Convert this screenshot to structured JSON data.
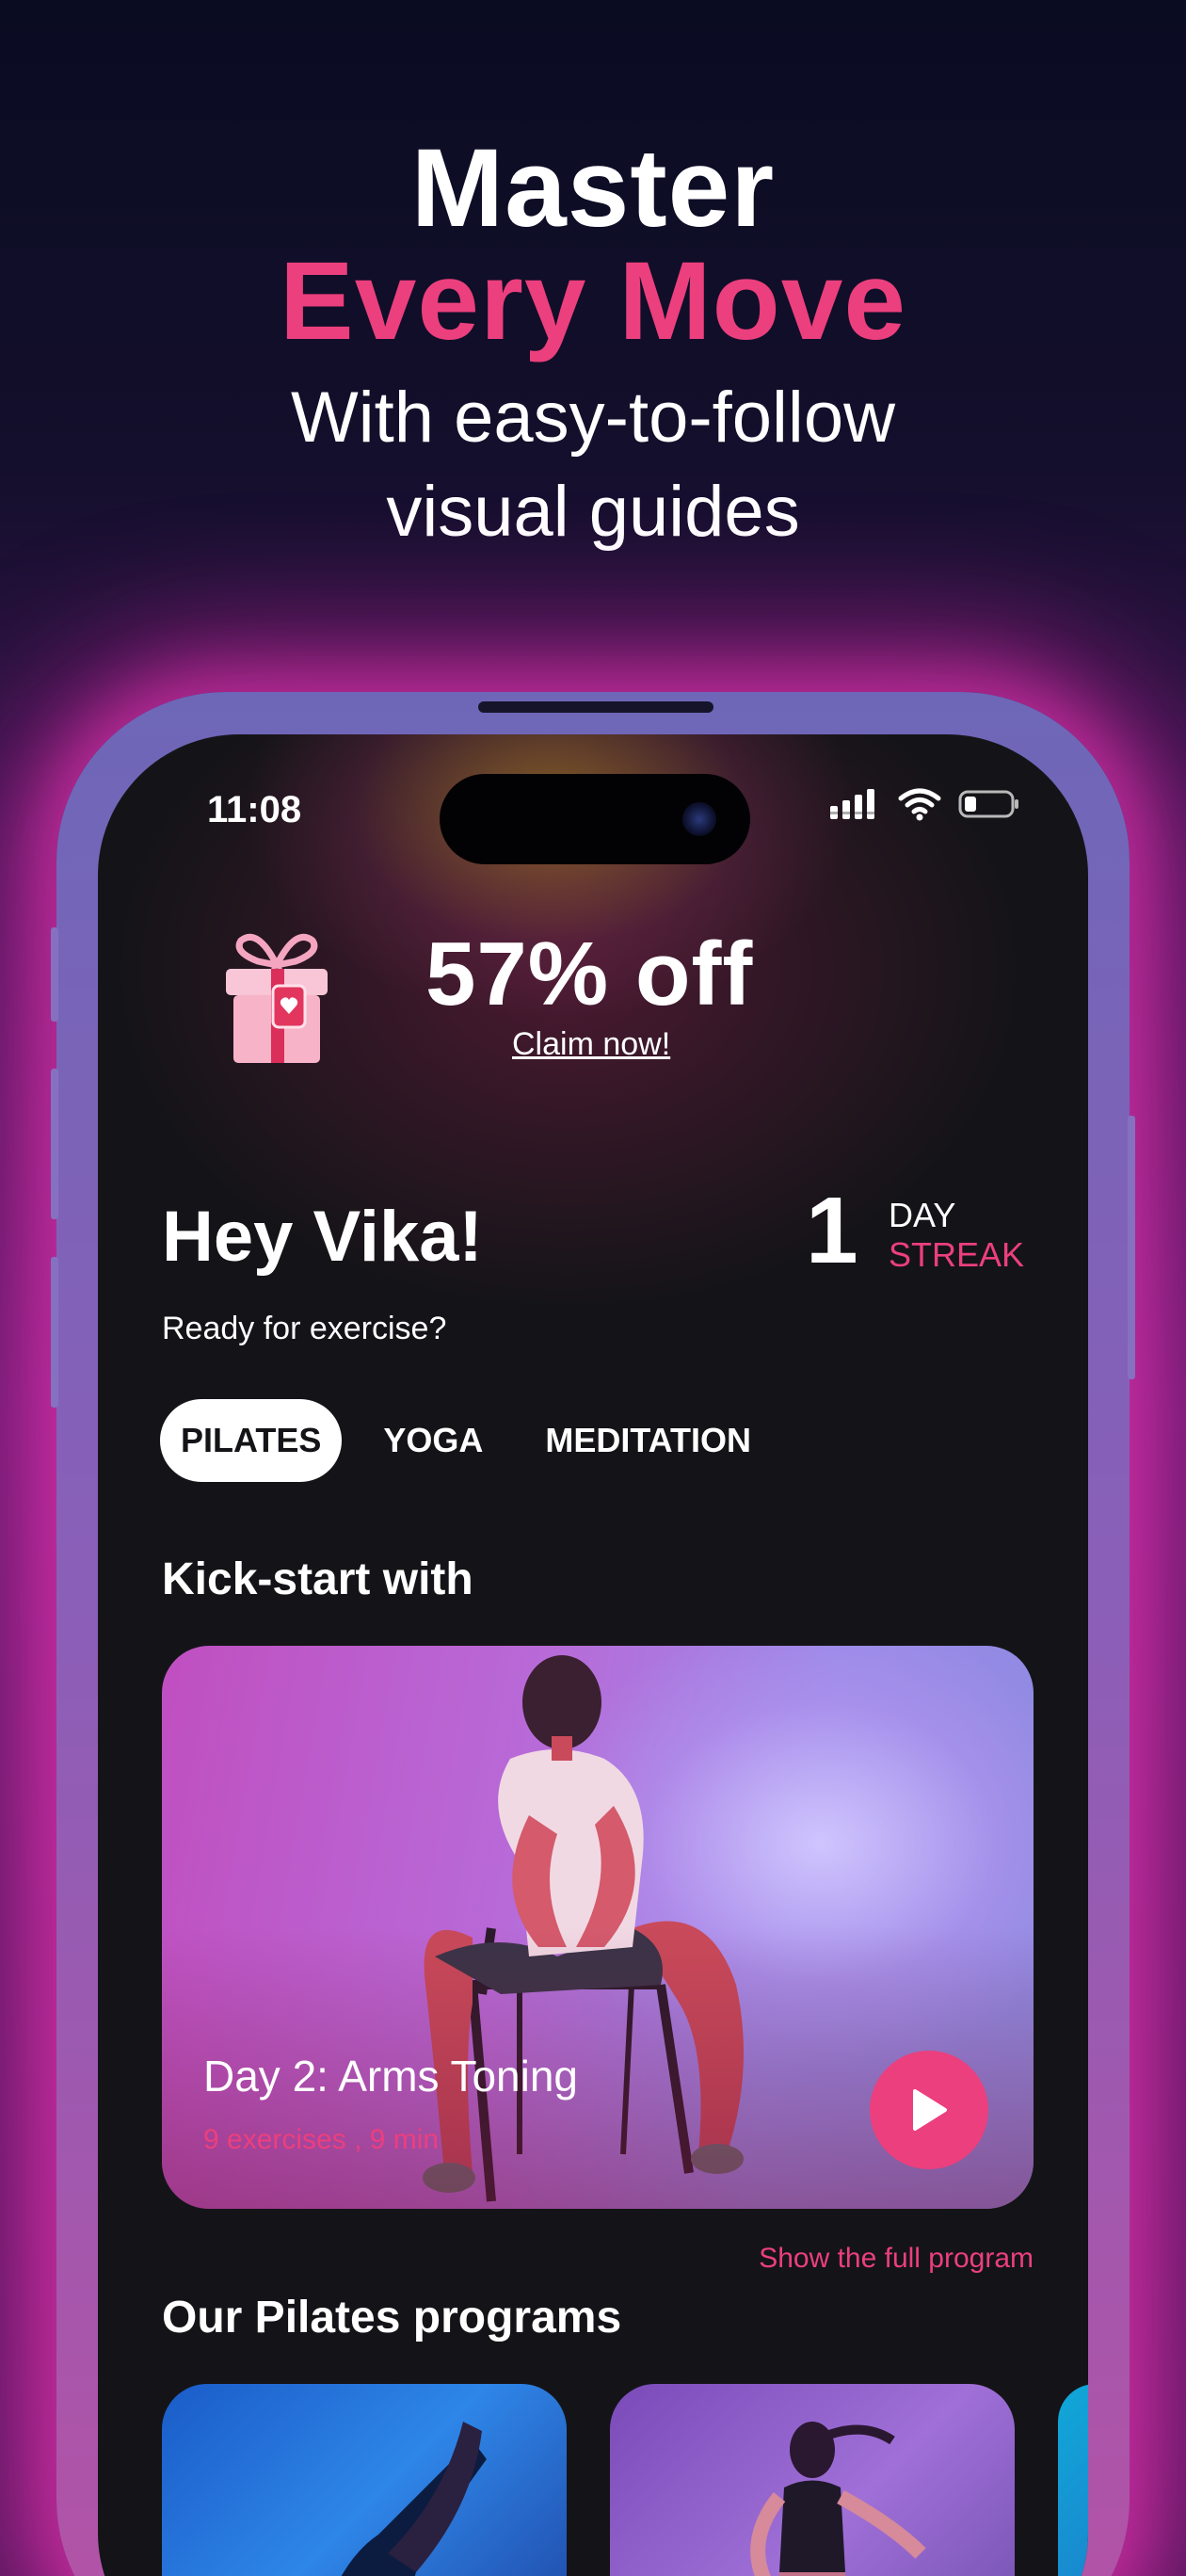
{
  "headline": {
    "line1": "Master",
    "line2": "Every Move",
    "line3": "With easy-to-follow",
    "line4": "visual guides"
  },
  "status_bar": {
    "time": "11:08"
  },
  "promo": {
    "title": "57% off",
    "link": "Claim now!"
  },
  "greeting": {
    "title": "Hey Vika!",
    "subtitle": "Ready for exercise?"
  },
  "streak": {
    "count": "1",
    "day": "DAY",
    "label": "STREAK"
  },
  "tabs": [
    {
      "label": "PILATES",
      "active": true
    },
    {
      "label": "YOGA",
      "active": false
    },
    {
      "label": "MEDITATION",
      "active": false
    }
  ],
  "kickstart": {
    "section_title": "Kick-start with",
    "card_title": "Day 2: Arms Toning",
    "card_meta": "9 exercises , 9 min",
    "show_full": "Show the full program"
  },
  "programs": {
    "section_title": "Our Pilates programs"
  },
  "colors": {
    "accent": "#ec3f7d",
    "screen_bg": "#141418"
  }
}
